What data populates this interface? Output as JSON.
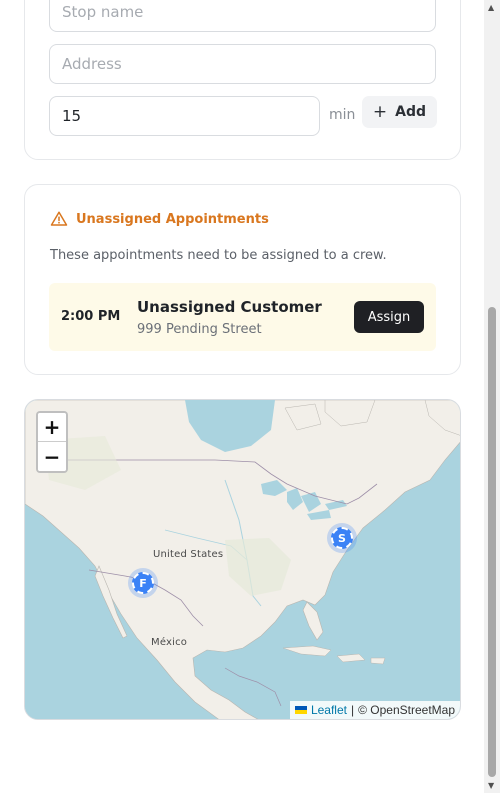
{
  "form": {
    "stop_name_placeholder": "Stop name",
    "address_placeholder": "Address",
    "minutes_value": "15",
    "minutes_unit": "min",
    "add_label": "Add",
    "add_icon": "plus-icon"
  },
  "unassigned": {
    "title": "Unassigned Appointments",
    "icon": "warning-triangle-icon",
    "description": "These appointments need to be assigned to a crew.",
    "accent_color": "#d9771f",
    "appointments": [
      {
        "time": "2:00 PM",
        "customer": "Unassigned Customer",
        "address": "999 Pending Street",
        "action": "Assign"
      }
    ]
  },
  "map": {
    "zoom_in": "+",
    "zoom_out": "−",
    "labels": {
      "country_us": "United States",
      "country_mx": "México"
    },
    "markers": [
      {
        "label": "F",
        "color": "#3b82f6"
      },
      {
        "label": "S",
        "color": "#3b82f6"
      }
    ],
    "attribution": {
      "link": "Leaflet",
      "separator": "|",
      "text": "© OpenStreetMap"
    }
  }
}
